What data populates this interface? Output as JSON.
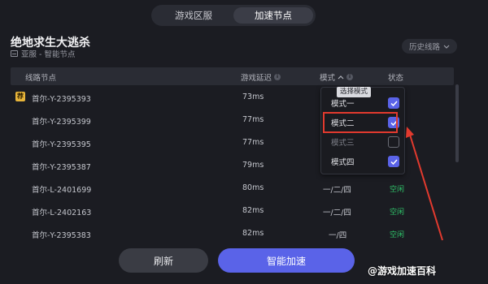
{
  "tabs": [
    {
      "label": "游戏区服",
      "active": false
    },
    {
      "label": "加速节点",
      "active": true
    }
  ],
  "game": {
    "title": "绝地求生大逃杀",
    "region": "亚服 - 智能节点"
  },
  "history_label": "历史线路",
  "table": {
    "columns": [
      "线路节点",
      "游戏延迟",
      "模式",
      "状态"
    ],
    "rows": [
      {
        "node": "首尔-Y-2395393",
        "latency": "73ms",
        "mode": "",
        "status": "",
        "recommended": true
      },
      {
        "node": "首尔-Y-2395399",
        "latency": "77ms",
        "mode": "",
        "status": ""
      },
      {
        "node": "首尔-Y-2395395",
        "latency": "77ms",
        "mode": "",
        "status": ""
      },
      {
        "node": "首尔-Y-2395387",
        "latency": "79ms",
        "mode": "",
        "status": ""
      },
      {
        "node": "首尔-L-2401699",
        "latency": "80ms",
        "mode": "一/二/四",
        "status": "空闲"
      },
      {
        "node": "首尔-L-2402163",
        "latency": "82ms",
        "mode": "一/二/四",
        "status": "空闲"
      },
      {
        "node": "首尔-Y-2395383",
        "latency": "82ms",
        "mode": "一/四",
        "status": "空闲"
      }
    ],
    "recommended_badge": "荐"
  },
  "mode_dropdown": {
    "tooltip": "选择模式",
    "options": [
      {
        "label": "模式一",
        "checked": true,
        "disabled": false
      },
      {
        "label": "模式二",
        "checked": true,
        "disabled": false
      },
      {
        "label": "模式三",
        "checked": false,
        "disabled": true
      },
      {
        "label": "模式四",
        "checked": true,
        "disabled": false
      }
    ]
  },
  "buttons": {
    "refresh": "刷新",
    "accelerate": "智能加速"
  },
  "watermark": "@游戏加速百科",
  "colors": {
    "accent": "#5a63e8",
    "free": "#2fc46a",
    "highlight": "#e23a2e",
    "badge": "#e8b53a"
  }
}
